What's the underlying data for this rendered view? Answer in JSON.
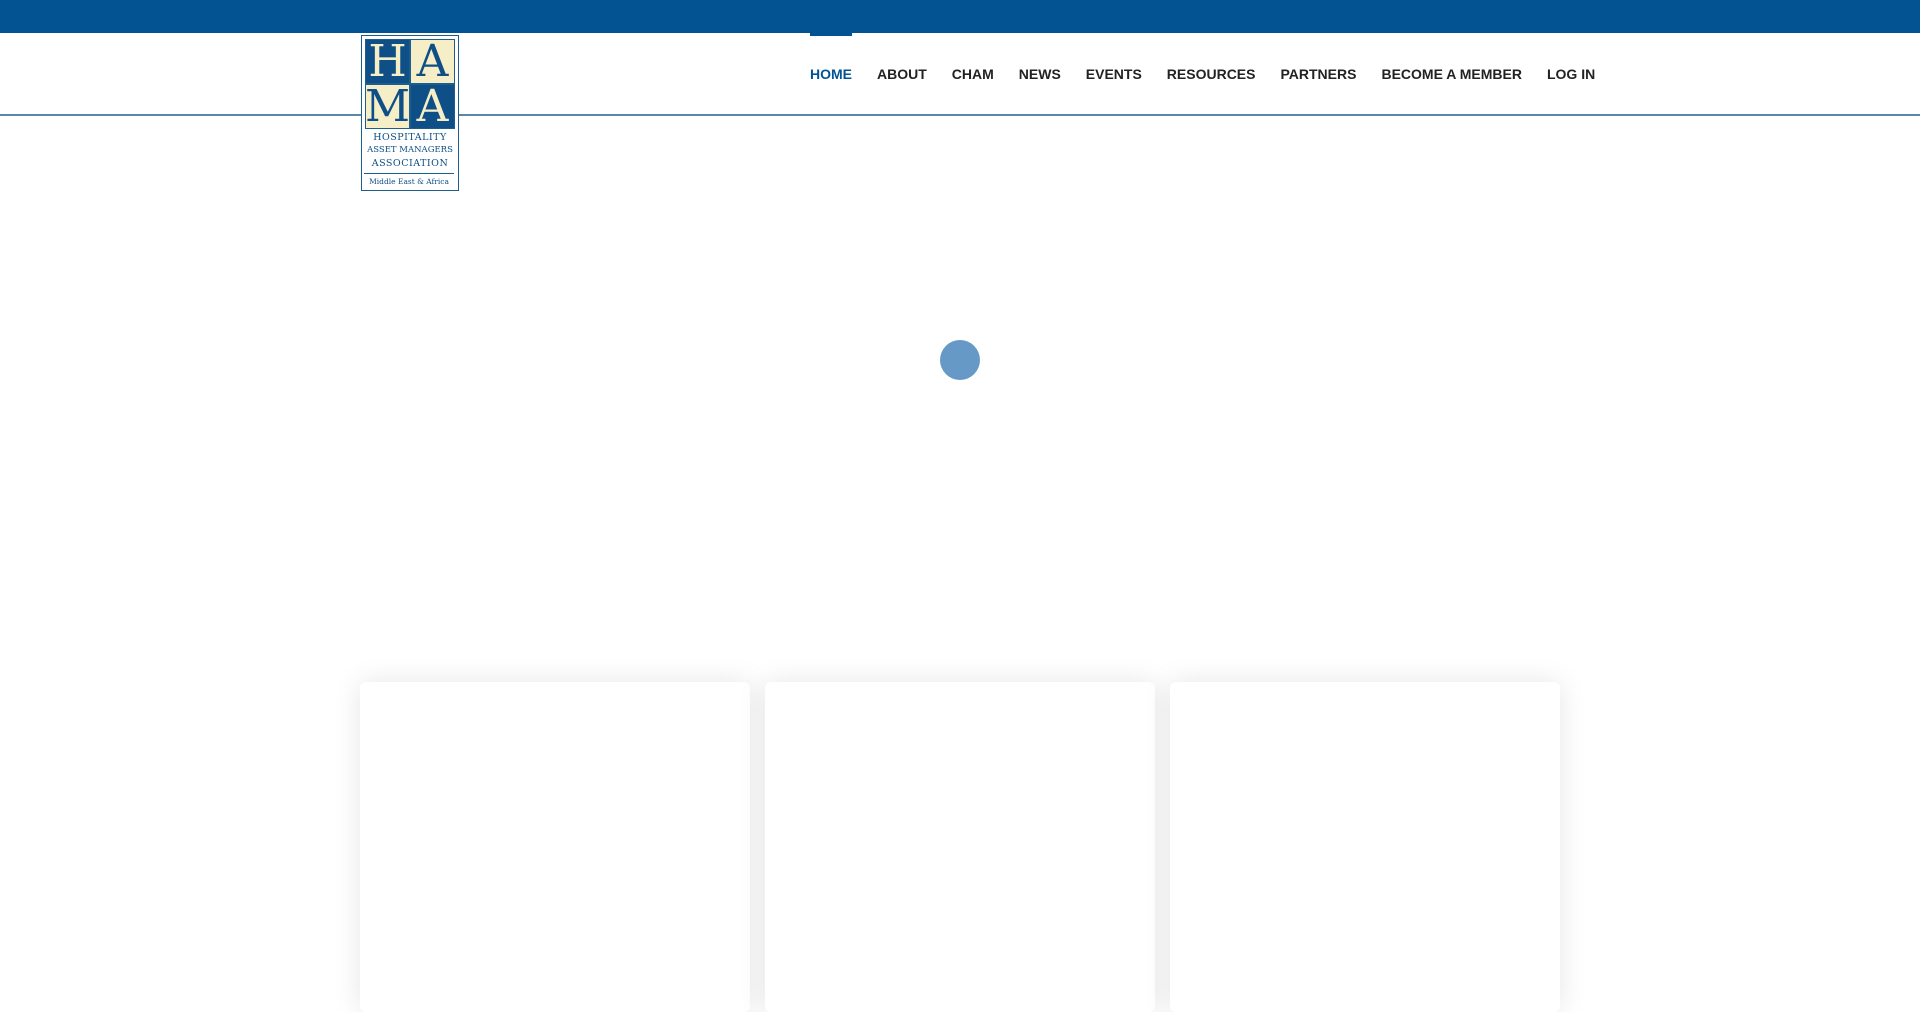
{
  "logo": {
    "letters": [
      "H",
      "A",
      "M",
      "A"
    ],
    "line1": "HOSPITALITY",
    "line2": "ASSET MANAGERS",
    "line3": "ASSOCIATION",
    "subtitle": "Middle East & Africa"
  },
  "nav": {
    "items": [
      {
        "label": "HOME",
        "active": true
      },
      {
        "label": "ABOUT"
      },
      {
        "label": "CHAM"
      },
      {
        "label": "NEWS"
      },
      {
        "label": "EVENTS"
      },
      {
        "label": "RESOURCES"
      },
      {
        "label": "PARTNERS"
      },
      {
        "label": "BECOME A MEMBER"
      },
      {
        "label": "LOG IN"
      }
    ]
  },
  "colors": {
    "brand_blue": "#035392",
    "logo_cream": "#f6eec6",
    "spinner": "#6699c5"
  }
}
